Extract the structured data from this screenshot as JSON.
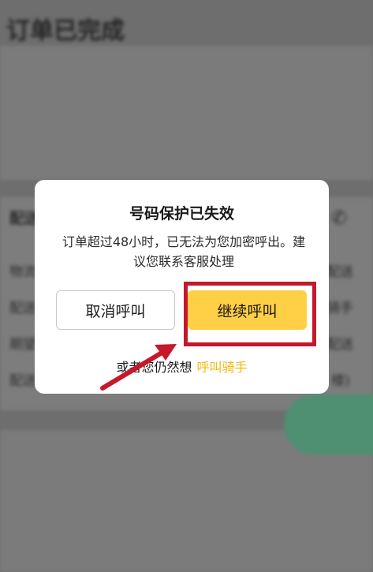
{
  "background": {
    "title": "订单已完成",
    "bg_labels": [
      "物流",
      "配送",
      "期望",
      "配送"
    ],
    "bg_right_labels": [
      "配送",
      "骑手",
      "配送",
      "楼)"
    ],
    "section_label": "配送"
  },
  "dialog": {
    "title": "号码保护已失效",
    "message": "订单超过48小时，已无法为您加密呼出。建议您联系客服处理",
    "cancel_label": "取消呼叫",
    "continue_label": "继续呼叫",
    "alt_prefix": "或者您仍然想",
    "alt_link": "呼叫骑手"
  },
  "colors": {
    "accent": "#ffcf45",
    "link": "#f3b90f",
    "highlight": "#c6182b"
  }
}
